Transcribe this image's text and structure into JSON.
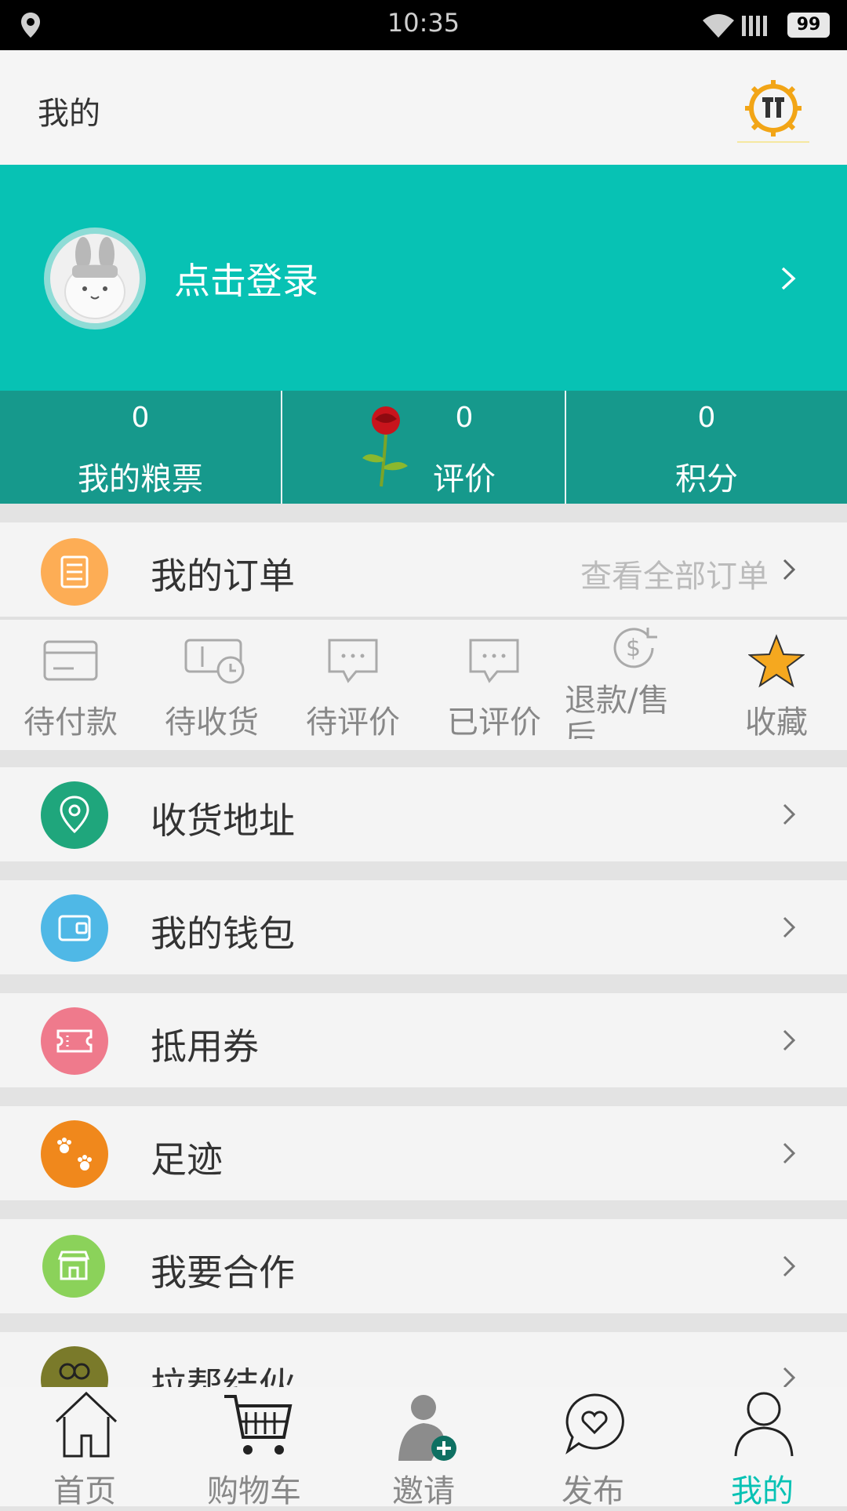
{
  "status_bar": {
    "time": "10:35",
    "battery": "99"
  },
  "header": {
    "title": "我的",
    "settings_icon": "settings-gear-icon"
  },
  "profile": {
    "login_text": "点击登录"
  },
  "stats": [
    {
      "value": "0",
      "label": "我的粮票"
    },
    {
      "value": "0",
      "label": "评价"
    },
    {
      "value": "0",
      "label": "积分"
    }
  ],
  "orders": {
    "title": "我的订单",
    "view_all": "查看全部订单",
    "items": [
      {
        "label": "待付款",
        "icon": "card-icon"
      },
      {
        "label": "待收货",
        "icon": "clock-ticket-icon"
      },
      {
        "label": "待评价",
        "icon": "chat-bubble-icon"
      },
      {
        "label": "已评价",
        "icon": "chat-bubble-icon"
      },
      {
        "label": "退款/售后",
        "icon": "refund-icon"
      },
      {
        "label": "收藏",
        "icon": "star-icon"
      }
    ]
  },
  "menu": [
    {
      "label": "收货地址",
      "color": "#1fa67c",
      "icon": "location-icon"
    },
    {
      "label": "我的钱包",
      "color": "#4fb8e6",
      "icon": "wallet-icon"
    },
    {
      "label": "抵用券",
      "color": "#ef7a8c",
      "icon": "coupon-icon"
    },
    {
      "label": "足迹",
      "color": "#f0881c",
      "icon": "paw-icon"
    },
    {
      "label": "我要合作",
      "color": "#8bd25a",
      "icon": "shop-icon"
    },
    {
      "label": "拉帮结伙",
      "color": "#7a7a2a",
      "icon": "group-icon"
    }
  ],
  "bottom_nav": [
    {
      "label": "首页",
      "icon": "home-icon",
      "active": false
    },
    {
      "label": "购物车",
      "icon": "cart-icon",
      "active": false
    },
    {
      "label": "邀请",
      "icon": "invite-icon",
      "active": false
    },
    {
      "label": "发布",
      "icon": "publish-icon",
      "active": false
    },
    {
      "label": "我的",
      "icon": "user-icon",
      "active": true
    }
  ],
  "colors": {
    "accent": "#07c2b4",
    "accent_dark": "#16998c",
    "active_nav": "#07c2b4"
  }
}
